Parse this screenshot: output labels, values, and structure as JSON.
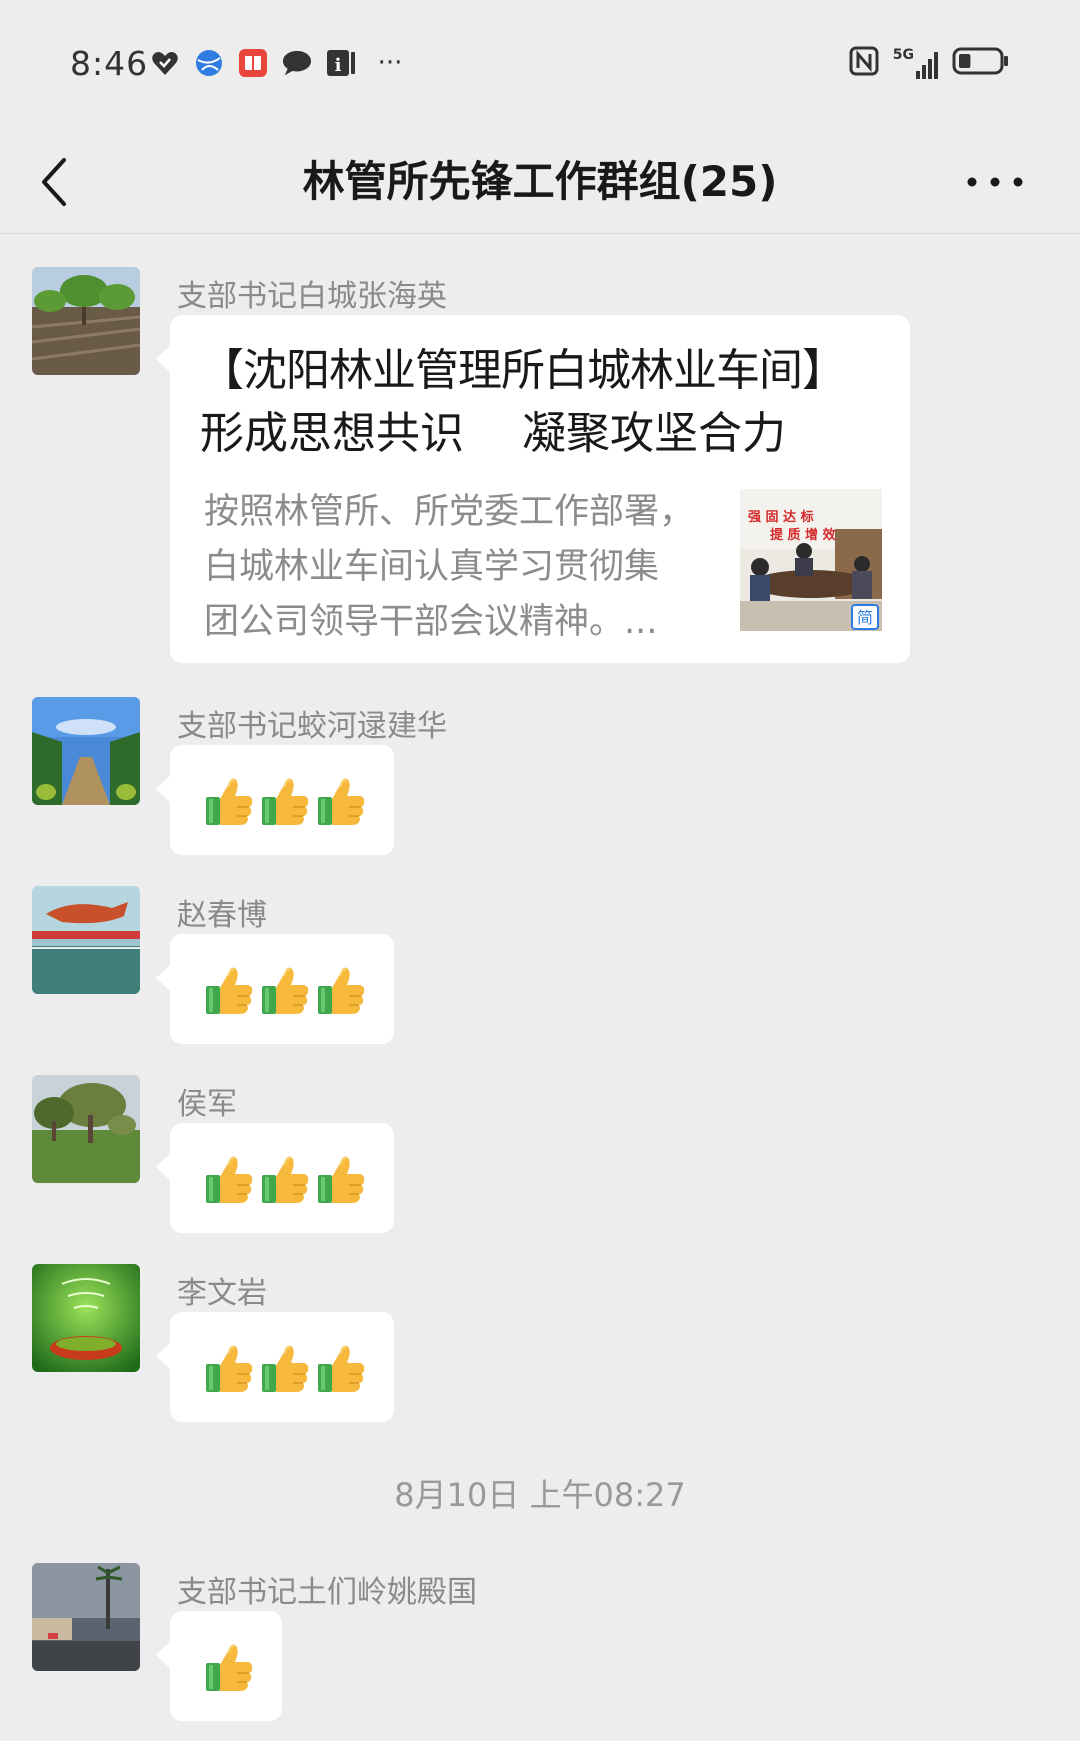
{
  "status_bar": {
    "time": "8:46",
    "icons": [
      "heart-icon",
      "globe-app-icon",
      "book-app-icon",
      "chat-bubble-icon",
      "info-icon",
      "more-dots"
    ],
    "overflow": "···",
    "right_icons": [
      "nfc-icon",
      "signal-5g-icon",
      "battery-icon"
    ],
    "network": "5G",
    "battery_level": 0.3
  },
  "nav": {
    "title": "林管所先锋工作群组(25)"
  },
  "messages": [
    {
      "sender": "支部书记白城张海英",
      "type": "article",
      "title_line1": "【沈阳林业管理所白城林业车间】",
      "title_line2": "形成思想共识　 凝聚攻坚合力",
      "desc_line1": "按照林管所、所党委工作部署，",
      "desc_line2": "白城林业车间认真学习贯彻集",
      "desc_line3": "团公司领导干部会议精神。...",
      "thumb_banner1": "强 固 达 标",
      "thumb_banner2": "提 质 增 效",
      "thumb_badge": "简"
    },
    {
      "sender": "支部书记蛟河逯建华",
      "type": "emoji",
      "emoji_count": 3
    },
    {
      "sender": "赵春博",
      "type": "emoji",
      "emoji_count": 3
    },
    {
      "sender": "侯军",
      "type": "emoji",
      "emoji_count": 3
    },
    {
      "sender": "李文岩",
      "type": "emoji",
      "emoji_count": 3
    }
  ],
  "timestamp": "8月10日 上午08:27",
  "messages_after": [
    {
      "sender": "支部书记土们岭姚殿国",
      "type": "emoji",
      "emoji_count": 1
    }
  ],
  "colors": {
    "background": "#ededed",
    "bubble": "#ffffff",
    "sender_text": "#8a8a8a",
    "thumb_yellow": "#f6b93b",
    "thumb_green": "#3fa84a"
  }
}
